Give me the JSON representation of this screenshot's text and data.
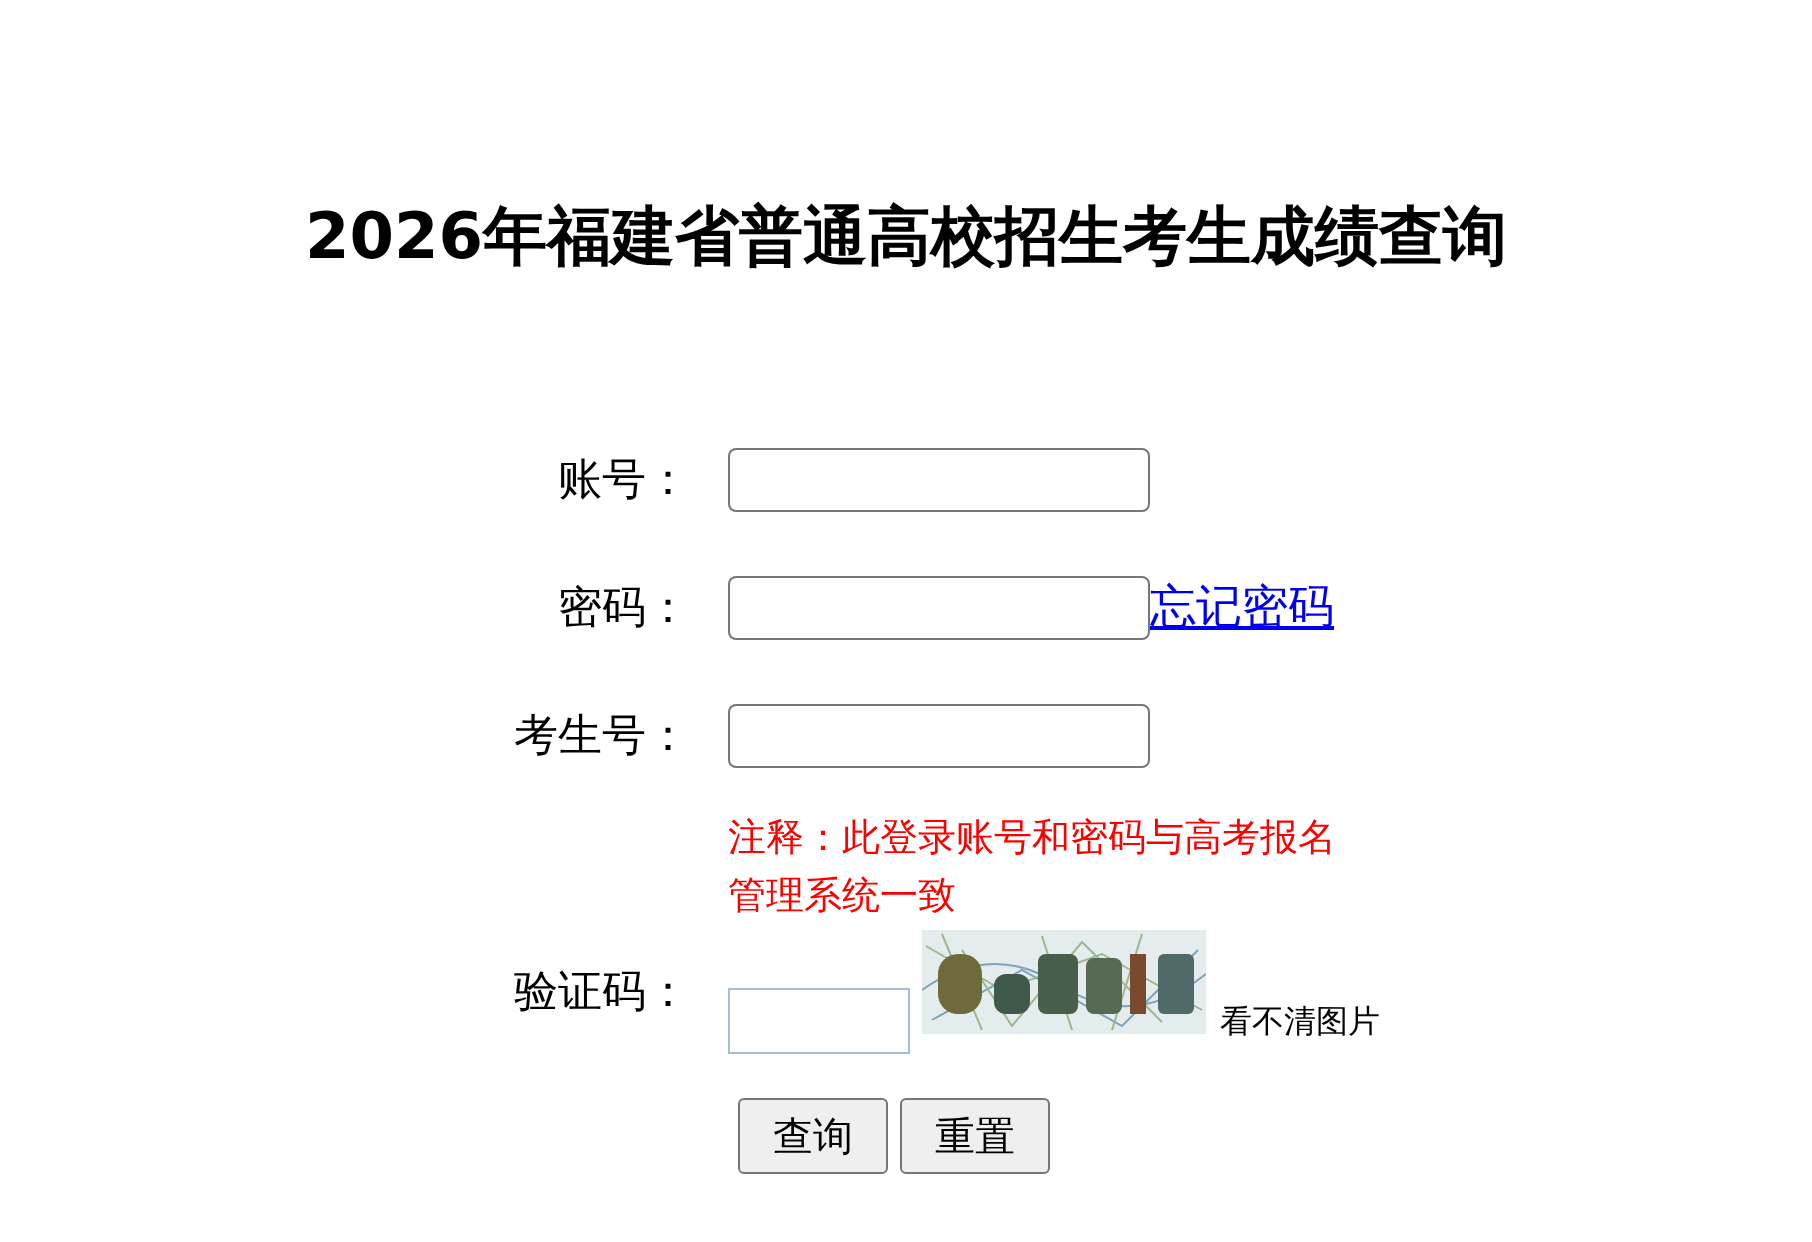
{
  "title": "2026年福建省普通高校招生考生成绩查询",
  "fields": [
    {
      "label": "账号："
    },
    {
      "label": "密码：",
      "link": "忘记密码"
    },
    {
      "label": "考生号："
    }
  ],
  "note": "注释：此登录账号和密码与高考报名管理系统一致",
  "captcha": {
    "label": "验证码：",
    "refresh_link": "看不清图片"
  },
  "buttons": [
    "查询",
    "重置"
  ]
}
